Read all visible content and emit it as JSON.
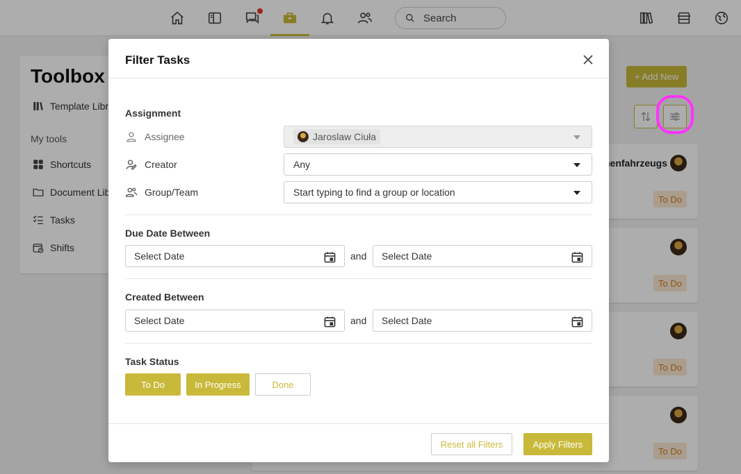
{
  "colors": {
    "accent": "#c9b93a",
    "notification": "#e5362f",
    "todo_badge_bg": "#fbe8d2",
    "todo_badge_text": "#d07a20",
    "highlight": "#ff33ff"
  },
  "topbar": {
    "icons": [
      "home-icon",
      "book-icon",
      "chat-icon",
      "briefcase-icon",
      "bell-icon",
      "people-icon",
      "library-icon",
      "store-icon",
      "globe-icon"
    ],
    "active": "briefcase-icon",
    "chat_has_notification": true,
    "search_placeholder": "Search"
  },
  "toolbox": {
    "title": "Toolbox",
    "template_library": "Template Libr",
    "section_label": "My tools",
    "items": [
      {
        "label": "Shortcuts",
        "icon": "grid-icon"
      },
      {
        "label": "Document Lib",
        "icon": "folder-icon"
      },
      {
        "label": "Tasks",
        "icon": "checklist-icon"
      },
      {
        "label": "Shifts",
        "icon": "calendar-clock-icon"
      }
    ]
  },
  "page": {
    "add_new_label": "+ Add New",
    "tasks": [
      {
        "title": "nenfahrzeugs",
        "status": "To Do"
      },
      {
        "title": "",
        "status": "To Do"
      },
      {
        "title": "",
        "status": "To Do"
      },
      {
        "title": "",
        "status": "To Do"
      }
    ]
  },
  "modal": {
    "title": "Filter Tasks",
    "assignment": {
      "section_title": "Assignment",
      "assignee_label": "Assignee",
      "assignee_value": "Jaroslaw Ciuła",
      "creator_label": "Creator",
      "creator_value": "Any",
      "group_label": "Group/Team",
      "group_placeholder": "Start typing to find a group or location"
    },
    "due_date": {
      "section_title": "Due Date Between",
      "from_placeholder": "Select Date",
      "and": "and",
      "to_placeholder": "Select Date"
    },
    "created": {
      "section_title": "Created Between",
      "from_placeholder": "Select Date",
      "and": "and",
      "to_placeholder": "Select Date"
    },
    "status": {
      "section_title": "Task Status",
      "options": [
        {
          "label": "To Do",
          "selected": true
        },
        {
          "label": "In Progress",
          "selected": true
        },
        {
          "label": "Done",
          "selected": false
        }
      ]
    },
    "footer": {
      "reset_label": "Reset all Filters",
      "apply_label": "Apply Filters"
    }
  }
}
